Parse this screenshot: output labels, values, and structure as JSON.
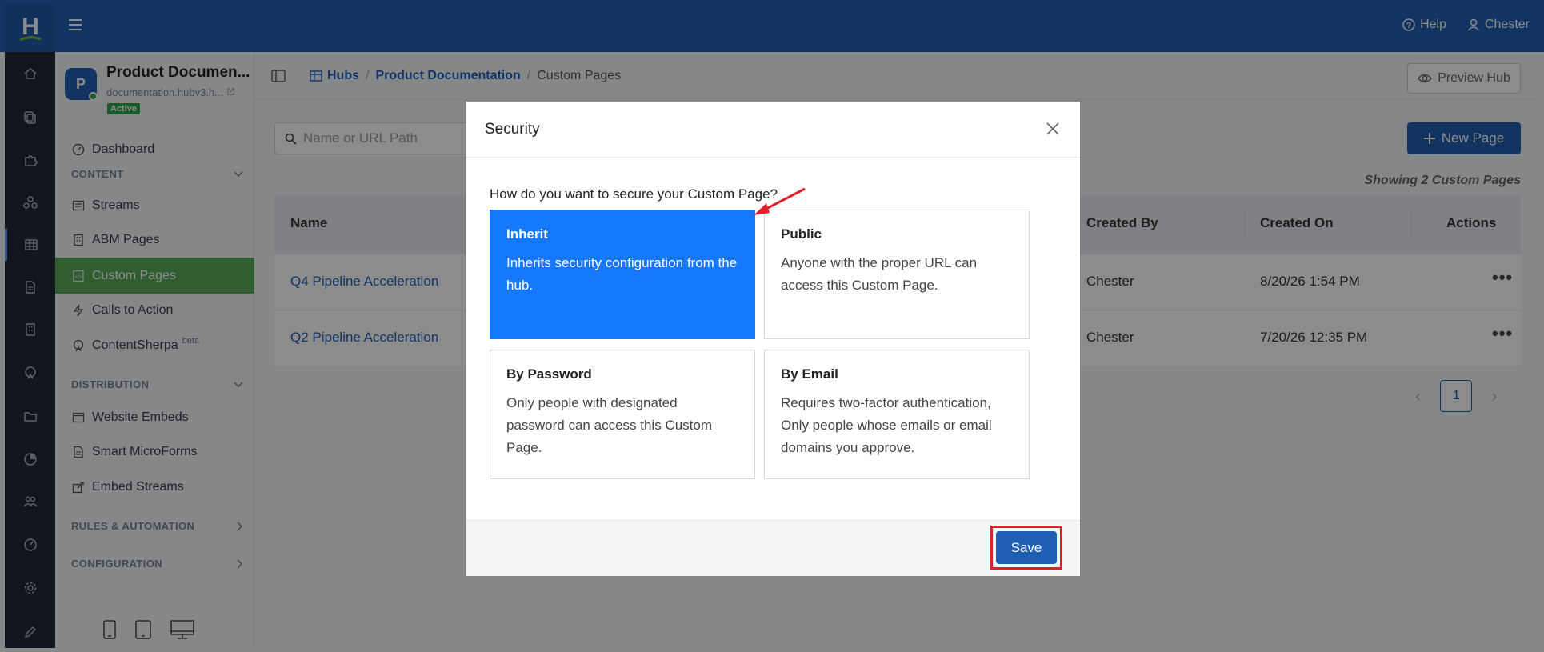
{
  "topbar": {
    "logo_letter": "H",
    "help_label": "Help",
    "user_label": "Chester"
  },
  "hub": {
    "avatar_letter": "P",
    "title": "Product Documen...",
    "url": "documentation.hubv3.h...",
    "status": "Active"
  },
  "sidebar": {
    "dashboard": "Dashboard",
    "content_section": "CONTENT",
    "content_items": [
      "Streams",
      "ABM Pages",
      "Custom Pages",
      "Calls to Action",
      "ContentSherpa"
    ],
    "beta_label": "beta",
    "distribution_section": "DISTRIBUTION",
    "distribution_items": [
      "Website Embeds",
      "Smart MicroForms",
      "Embed Streams"
    ],
    "rules_section": "RULES & AUTOMATION",
    "configuration_section": "CONFIGURATION"
  },
  "breadcrumb": {
    "hubs": "Hubs",
    "separator": "/",
    "product_documentation": "Product Documentation",
    "current": "Custom Pages"
  },
  "toolbar": {
    "preview_hub": "Preview Hub",
    "search_placeholder": "Name or URL Path",
    "new_page": "New Page",
    "showing": "Showing 2 Custom Pages"
  },
  "table": {
    "headers": {
      "name": "Name",
      "created_by": "Created By",
      "created_on": "Created On",
      "actions": "Actions"
    },
    "rows": [
      {
        "name": "Q4 Pipeline Acceleration",
        "created_by": "Chester",
        "created_on": "8/20/26 1:54 PM",
        "actions": "•••"
      },
      {
        "name": "Q2 Pipeline Acceleration",
        "created_by": "Chester",
        "created_on": "7/20/26 12:35 PM",
        "actions": "•••"
      }
    ]
  },
  "pagination": {
    "prev": "‹",
    "current_page": "1",
    "next": "›"
  },
  "modal": {
    "title": "Security",
    "question": "How do you want to secure your Custom Page?",
    "options": [
      {
        "title": "Inherit",
        "description": "Inherits security configuration from the hub.",
        "selected": true
      },
      {
        "title": "Public",
        "description": "Anyone with the proper URL can access this Custom Page.",
        "selected": false
      },
      {
        "title": "By Password",
        "description": "Only people with designated password can access this Custom Page.",
        "selected": false
      },
      {
        "title": "By Email",
        "description": "Requires two-factor authentication, Only people whose emails or email domains you approve.",
        "selected": false
      }
    ],
    "save_label": "Save"
  },
  "colors": {
    "brand_blue": "#1f5fb3",
    "selected_option": "#1677ff",
    "active_nav": "#5aac5a",
    "annotation_red": "#e11d2a"
  }
}
